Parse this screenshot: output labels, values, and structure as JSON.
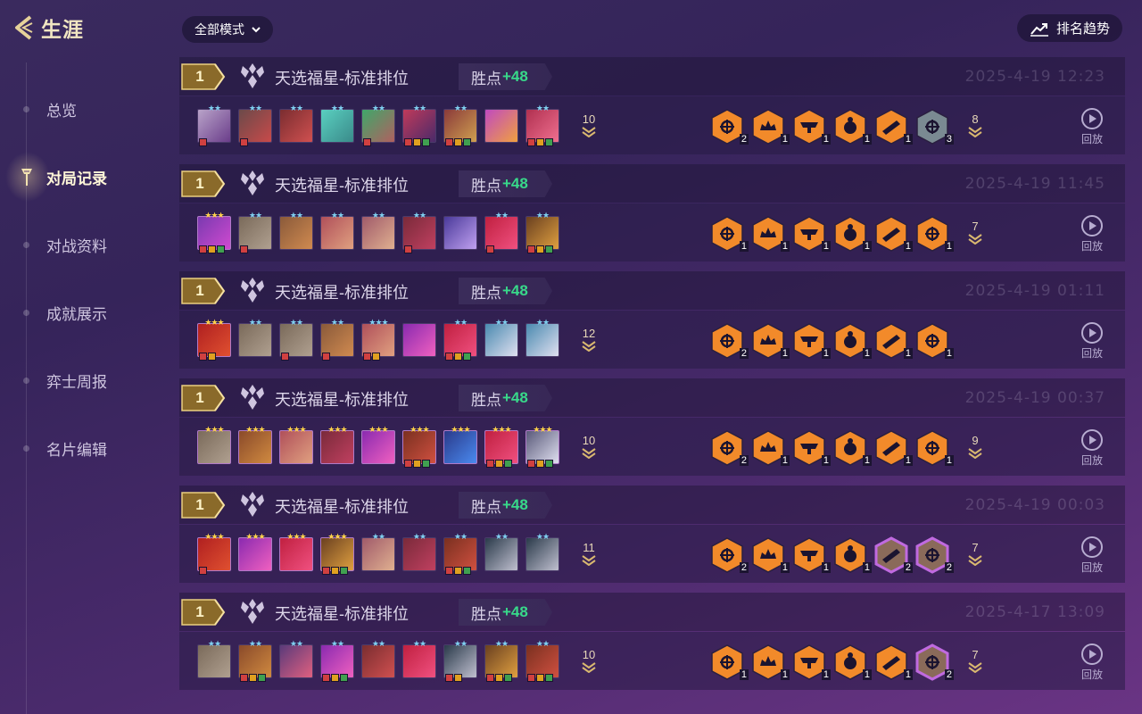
{
  "header": {
    "back_title": "生涯",
    "mode_filter": "全部模式",
    "trend_button": "排名趋势"
  },
  "nav": {
    "items": [
      {
        "label": "总览",
        "active": false
      },
      {
        "label": "对局记录",
        "active": true
      },
      {
        "label": "对战资料",
        "active": false
      },
      {
        "label": "成就展示",
        "active": false
      },
      {
        "label": "弈士周报",
        "active": false
      },
      {
        "label": "名片编辑",
        "active": false
      }
    ]
  },
  "matches": [
    {
      "rank": "1",
      "mode": "天选福星-标准排位",
      "points_label": "胜点",
      "points": "+48",
      "date": "2025-4-19 12:23",
      "level": "10",
      "trait_count": "8",
      "replay": "回放",
      "units": [
        [
          "#b9a3c9",
          "#6a3d8a",
          2,
          "blue",
          1
        ],
        [
          "#6b4a4a",
          "#c84a4a",
          2,
          "blue",
          1
        ],
        [
          "#7a2d30",
          "#d05050",
          2,
          "blue",
          0
        ],
        [
          "#5ad0c0",
          "#3a8a8a",
          2,
          "blue",
          0
        ],
        [
          "#3fa86a",
          "#b06060",
          2,
          "blue",
          1
        ],
        [
          "#c03a5a",
          "#4a2a6a",
          2,
          "blue",
          3
        ],
        [
          "#8a3a3a",
          "#d0a050",
          2,
          "blue",
          3
        ],
        [
          "#c04ac0",
          "#f0a040",
          0,
          "blue",
          0
        ],
        [
          "#b03050",
          "#f07090",
          2,
          "blue",
          3
        ]
      ],
      "traits": [
        [
          "#f28a2a",
          "2"
        ],
        [
          "#f28a2a",
          "1"
        ],
        [
          "#f28a2a",
          "1"
        ],
        [
          "#f28a2a",
          "1"
        ],
        [
          "#f28a2a",
          "1"
        ],
        [
          "#7a8a92",
          "3"
        ]
      ]
    },
    {
      "rank": "1",
      "mode": "天选福星-标准排位",
      "points_label": "胜点",
      "points": "+48",
      "date": "2025-4-19 11:45",
      "level": "",
      "trait_count": "7",
      "replay": "回放",
      "units": [
        [
          "#7a3ab0",
          "#d04ad0",
          3,
          "gold",
          3
        ],
        [
          "#7a6a5a",
          "#b0a090",
          2,
          "blue",
          1
        ],
        [
          "#8a5a3a",
          "#d08a50",
          2,
          "blue",
          0
        ],
        [
          "#b0505a",
          "#e0a080",
          2,
          "blue",
          0
        ],
        [
          "#a05a6a",
          "#e0b090",
          2,
          "blue",
          0
        ],
        [
          "#7a2a3a",
          "#c04060",
          2,
          "blue",
          1
        ],
        [
          "#4a3a9a",
          "#c0a0f0",
          0,
          "blue",
          0
        ],
        [
          "#c02040",
          "#f05080",
          2,
          "blue",
          1
        ],
        [
          "#6a4020",
          "#e0a040",
          2,
          "blue",
          3
        ]
      ],
      "traits": [
        [
          "#f28a2a",
          "1"
        ],
        [
          "#f28a2a",
          "1"
        ],
        [
          "#f28a2a",
          "1"
        ],
        [
          "#f28a2a",
          "1"
        ],
        [
          "#f28a2a",
          "1"
        ],
        [
          "#f28a2a",
          "1"
        ]
      ]
    },
    {
      "rank": "1",
      "mode": "天选福星-标准排位",
      "points_label": "胜点",
      "points": "+48",
      "date": "2025-4-19 01:11",
      "level": "12",
      "trait_count": "",
      "replay": "回放",
      "units": [
        [
          "#b02020",
          "#e05030",
          3,
          "gold",
          2
        ],
        [
          "#7a6a5a",
          "#b0a090",
          2,
          "blue",
          0
        ],
        [
          "#7a6a5a",
          "#b0a090",
          2,
          "blue",
          1
        ],
        [
          "#8a5a3a",
          "#d08a50",
          2,
          "blue",
          1
        ],
        [
          "#b0505a",
          "#e0a080",
          3,
          "blue",
          2
        ],
        [
          "#8a2ab0",
          "#f060c0",
          0,
          "blue",
          0
        ],
        [
          "#c02040",
          "#f05080",
          2,
          "blue",
          3
        ],
        [
          "#4a8ab0",
          "#e0e0f0",
          2,
          "blue",
          0
        ],
        [
          "#4a8ab0",
          "#e0e0f0",
          2,
          "blue",
          0
        ]
      ],
      "traits": [
        [
          "#f28a2a",
          "2"
        ],
        [
          "#f28a2a",
          "1"
        ],
        [
          "#f28a2a",
          "1"
        ],
        [
          "#f28a2a",
          "1"
        ],
        [
          "#f28a2a",
          "1"
        ],
        [
          "#f28a2a",
          "1"
        ]
      ]
    },
    {
      "rank": "1",
      "mode": "天选福星-标准排位",
      "points_label": "胜点",
      "points": "+48",
      "date": "2025-4-19 00:37",
      "level": "10",
      "trait_count": "9",
      "replay": "回放",
      "units": [
        [
          "#7a6a5a",
          "#b0a090",
          3,
          "gold",
          0
        ],
        [
          "#8a4a2a",
          "#d08a40",
          3,
          "gold",
          0
        ],
        [
          "#b0505a",
          "#e0a080",
          3,
          "gold",
          0
        ],
        [
          "#7a2a3a",
          "#c04060",
          3,
          "gold",
          0
        ],
        [
          "#8a2ab0",
          "#f060c0",
          3,
          "gold",
          0
        ],
        [
          "#7a3020",
          "#d05040",
          3,
          "gold",
          3
        ],
        [
          "#2a3a8a",
          "#4a8af0",
          3,
          "gold",
          0
        ],
        [
          "#c02040",
          "#f05080",
          3,
          "gold",
          3
        ],
        [
          "#5a5a7a",
          "#e0e0f0",
          3,
          "gold",
          3
        ]
      ],
      "traits": [
        [
          "#f28a2a",
          "2"
        ],
        [
          "#f28a2a",
          "1"
        ],
        [
          "#f28a2a",
          "1"
        ],
        [
          "#f28a2a",
          "1"
        ],
        [
          "#f28a2a",
          "1"
        ],
        [
          "#f28a2a",
          "1"
        ]
      ]
    },
    {
      "rank": "1",
      "mode": "天选福星-标准排位",
      "points_label": "胜点",
      "points": "+48",
      "date": "2025-4-19 00:03",
      "level": "11",
      "trait_count": "7",
      "replay": "回放",
      "units": [
        [
          "#b02020",
          "#e05030",
          3,
          "gold",
          1
        ],
        [
          "#8a2ab0",
          "#f060c0",
          3,
          "gold",
          0
        ],
        [
          "#c02040",
          "#f05080",
          3,
          "gold",
          0
        ],
        [
          "#6a4020",
          "#e0a040",
          3,
          "gold",
          3
        ],
        [
          "#a05a6a",
          "#e0b090",
          2,
          "blue",
          0
        ],
        [
          "#7a2a3a",
          "#c04060",
          2,
          "blue",
          0
        ],
        [
          "#7a3020",
          "#d05040",
          2,
          "blue",
          3
        ],
        [
          "#2a3a4a",
          "#c0c0d0",
          2,
          "blue",
          0
        ],
        [
          "#2a3a4a",
          "#c0c0d0",
          2,
          "blue",
          0
        ]
      ],
      "traits": [
        [
          "#f28a2a",
          "2"
        ],
        [
          "#f28a2a",
          "1"
        ],
        [
          "#f28a2a",
          "1"
        ],
        [
          "#f28a2a",
          "1"
        ],
        [
          "#8a6a5a",
          "2"
        ],
        [
          "#8a6a5a",
          "2"
        ]
      ]
    },
    {
      "rank": "1",
      "mode": "天选福星-标准排位",
      "points_label": "胜点",
      "points": "+48",
      "date": "2025-4-17 13:09",
      "level": "10",
      "trait_count": "7",
      "replay": "回放",
      "units": [
        [
          "#7a6a5a",
          "#b0a090",
          2,
          "blue",
          0
        ],
        [
          "#8a4a2a",
          "#d08a40",
          2,
          "blue",
          3
        ],
        [
          "#5a3a7a",
          "#e06080",
          2,
          "blue",
          0
        ],
        [
          "#8a2ab0",
          "#f060c0",
          2,
          "blue",
          3
        ],
        [
          "#7a2d30",
          "#d05050",
          2,
          "blue",
          0
        ],
        [
          "#c02040",
          "#f05080",
          2,
          "blue",
          0
        ],
        [
          "#2a3a4a",
          "#c0c0d0",
          2,
          "blue",
          2
        ],
        [
          "#6a4020",
          "#e0a040",
          2,
          "blue",
          3
        ],
        [
          "#7a3020",
          "#d05040",
          2,
          "blue",
          3
        ]
      ],
      "traits": [
        [
          "#f28a2a",
          "1"
        ],
        [
          "#f28a2a",
          "1"
        ],
        [
          "#f28a2a",
          "1"
        ],
        [
          "#f28a2a",
          "1"
        ],
        [
          "#f28a2a",
          "1"
        ],
        [
          "#8a6a5a",
          "2"
        ]
      ]
    }
  ]
}
